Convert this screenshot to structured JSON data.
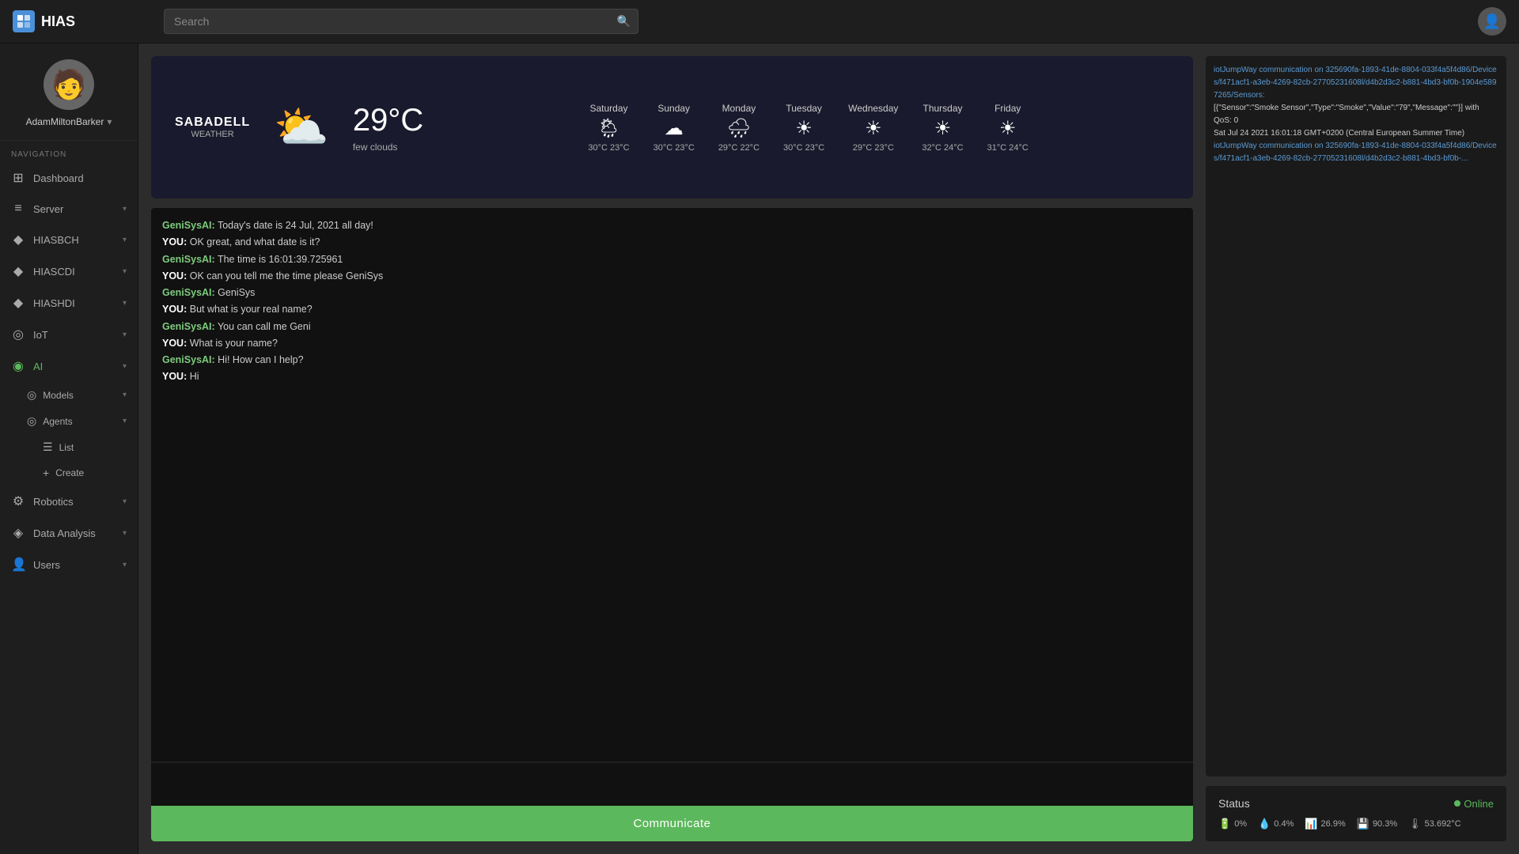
{
  "app": {
    "name": "HIAS",
    "logo_icon": "H"
  },
  "topbar": {
    "search_placeholder": "Search",
    "user_avatar": "👤"
  },
  "sidebar": {
    "user": {
      "name": "AdamMiltonBarker",
      "avatar": "👤"
    },
    "nav_label": "NAVIGATION",
    "items": [
      {
        "id": "dashboard",
        "label": "Dashboard",
        "icon": "⊞",
        "has_children": false
      },
      {
        "id": "server",
        "label": "Server",
        "icon": "≡",
        "has_children": true
      },
      {
        "id": "hiasbch",
        "label": "HIASBCH",
        "icon": "◆",
        "has_children": true
      },
      {
        "id": "hiascdi",
        "label": "HIASCDI",
        "icon": "◆",
        "has_children": true
      },
      {
        "id": "hiashdi",
        "label": "HIASHDI",
        "icon": "◆",
        "has_children": true
      },
      {
        "id": "iot",
        "label": "IoT",
        "icon": "◎",
        "has_children": true
      },
      {
        "id": "ai",
        "label": "AI",
        "icon": "◉",
        "has_children": true,
        "active": true
      },
      {
        "id": "robotics",
        "label": "Robotics",
        "icon": "⚙",
        "has_children": true
      },
      {
        "id": "data-analysis",
        "label": "Data Analysis",
        "icon": "◈",
        "has_children": true
      },
      {
        "id": "users",
        "label": "Users",
        "icon": "👤",
        "has_children": true
      }
    ],
    "ai_sub": {
      "models": "Models",
      "agents": "Agents",
      "sub_agents": [
        {
          "label": "List",
          "icon": "☰"
        },
        {
          "label": "Create",
          "icon": "+"
        }
      ]
    }
  },
  "weather": {
    "location_city": "SABADELL",
    "location_label": "WEATHER",
    "current_temp": "29°C",
    "current_desc": "few clouds",
    "current_icon": "⛅",
    "forecast": [
      {
        "day": "Saturday",
        "icon": "🌦",
        "high": "30°C",
        "low": "23°C"
      },
      {
        "day": "Sunday",
        "icon": "☁",
        "high": "30°C",
        "low": "23°C"
      },
      {
        "day": "Monday",
        "icon": "🌧",
        "high": "29°C",
        "low": "22°C"
      },
      {
        "day": "Tuesday",
        "icon": "☀",
        "high": "30°C",
        "low": "23°C"
      },
      {
        "day": "Wednesday",
        "icon": "☀",
        "high": "29°C",
        "low": "23°C"
      },
      {
        "day": "Thursday",
        "icon": "☀",
        "high": "32°C",
        "low": "24°C"
      },
      {
        "day": "Friday",
        "icon": "☀",
        "high": "31°C",
        "low": "24°C"
      }
    ]
  },
  "chat": {
    "messages": [
      {
        "sender": "GeniSysAI",
        "type": "geni",
        "text": "Today's date is 24 Jul, 2021 all day!"
      },
      {
        "sender": "YOU",
        "type": "you",
        "text": "OK great, and what date is it?"
      },
      {
        "sender": "GeniSysAI",
        "type": "geni",
        "text": "The time is 16:01:39.725961"
      },
      {
        "sender": "YOU",
        "type": "you",
        "text": "OK can you tell me the time please GeniSys"
      },
      {
        "sender": "GeniSysAI",
        "type": "geni",
        "text": "GeniSys"
      },
      {
        "sender": "YOU",
        "type": "you",
        "text": "But what is your real name?"
      },
      {
        "sender": "GeniSysAI",
        "type": "geni",
        "text": "You can call me Geni"
      },
      {
        "sender": "YOU",
        "type": "you",
        "text": "What is your name?"
      },
      {
        "sender": "GeniSysAI",
        "type": "geni",
        "text": "Hi! How can I help?"
      },
      {
        "sender": "YOU",
        "type": "you",
        "text": "Hi"
      }
    ],
    "input_placeholder": "",
    "communicate_label": "Communicate"
  },
  "log": {
    "entries": [
      {
        "type": "link",
        "text": "iotJumpWay communication on 325690fa-1893-41de-8804-033f4a5f4d86/Devices/f471acf1-a3eb-4269-82cb-27705231608l/d4b2d3c2-b881-4bd3-bf0b-1904e5897265/Sensors:"
      },
      {
        "type": "text",
        "text": "[{\"Sensor\":\"Smoke Sensor\",\"Type\":\"Smoke\",\"Value\":\"79\",\"Message\":\"\"}] with QoS: 0"
      },
      {
        "type": "text",
        "text": "Sat Jul 24 2021 16:01:18 GMT+0200 (Central European Summer Time)"
      },
      {
        "type": "link",
        "text": "iotJumpWay communication on 325690fa-1893-41de-8804-033f4a5f4d86/Devices/f471acf1-a3eb-4269-82cb-27705231608l/d4b2d3c2-b881-4bd3-bf0b-..."
      }
    ]
  },
  "status": {
    "title": "Status",
    "online_label": "Online",
    "metrics": [
      {
        "icon": "🔋",
        "value": "0%",
        "id": "battery"
      },
      {
        "icon": "💧",
        "value": "0.4%",
        "id": "humidity"
      },
      {
        "icon": "📊",
        "value": "26.9%",
        "id": "cpu"
      },
      {
        "icon": "💾",
        "value": "90.3%",
        "id": "memory"
      },
      {
        "icon": "🌡",
        "value": "53.692°C",
        "id": "temp"
      }
    ]
  }
}
